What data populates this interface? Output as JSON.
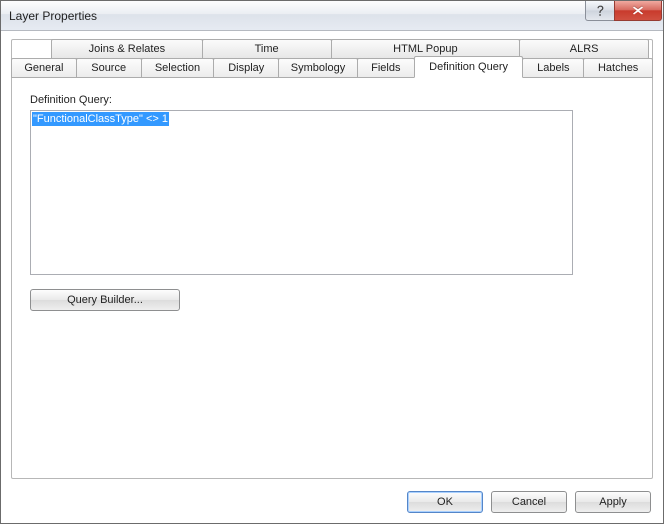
{
  "window": {
    "title": "Layer Properties"
  },
  "tabs": {
    "row1": [
      {
        "label": "Joins & Relates"
      },
      {
        "label": "Time"
      },
      {
        "label": "HTML Popup"
      },
      {
        "label": "ALRS"
      }
    ],
    "row2": [
      {
        "label": "General"
      },
      {
        "label": "Source"
      },
      {
        "label": "Selection"
      },
      {
        "label": "Display"
      },
      {
        "label": "Symbology"
      },
      {
        "label": "Fields"
      },
      {
        "label": "Definition Query",
        "active": true
      },
      {
        "label": "Labels"
      },
      {
        "label": "Hatches"
      }
    ]
  },
  "panel": {
    "label": "Definition Query:",
    "query_text": "\"FunctionalClassType\" <> 1",
    "query_selected": true,
    "builder_button": "Query Builder..."
  },
  "buttons": {
    "ok": "OK",
    "cancel": "Cancel",
    "apply": "Apply"
  }
}
